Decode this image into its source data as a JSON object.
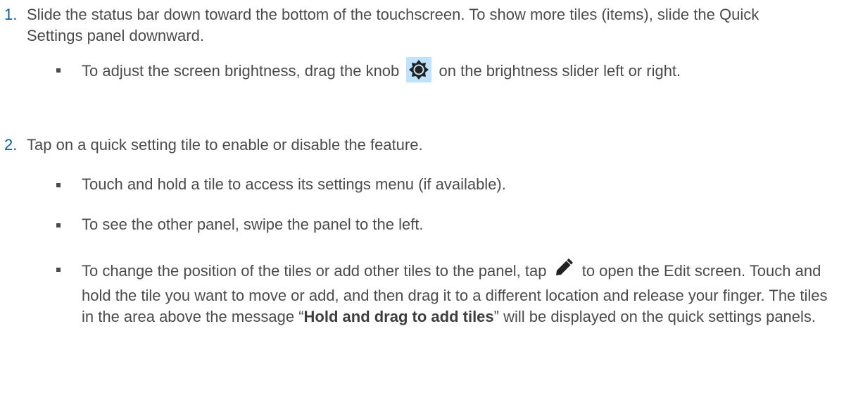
{
  "steps": [
    {
      "number": "1.",
      "text": "Slide the status bar down toward the bottom of the touchscreen. To show more tiles (items), slide the Quick Settings panel downward.",
      "bullets": [
        {
          "before": "To adjust the screen brightness, drag the knob",
          "icon": "brightness-knob-icon",
          "after": "on the brightness slider left or right."
        }
      ]
    },
    {
      "number": "2.",
      "text": "Tap on a quick setting tile to enable or disable the feature.",
      "bullets": [
        {
          "text": "Touch and hold a tile to access its settings menu (if available)."
        },
        {
          "text": "To see the other panel, swipe the panel to the left."
        },
        {
          "before": "To change the position of the tiles or add other tiles to the panel, tap",
          "icon": "pencil-edit-icon",
          "after": "to open the Edit screen. Touch and hold the tile you want to move or add, and then drag it to a different location and release your finger. The tiles in the area above the message “",
          "bold": "Hold and drag to add tiles",
          "tail": "” will be displayed on the quick settings panels."
        }
      ]
    }
  ],
  "colors": {
    "text": "#4b4b4b",
    "step_number": "#0a5ea8",
    "knob_highlight": "#bfe3ff",
    "icon": "#222222"
  }
}
